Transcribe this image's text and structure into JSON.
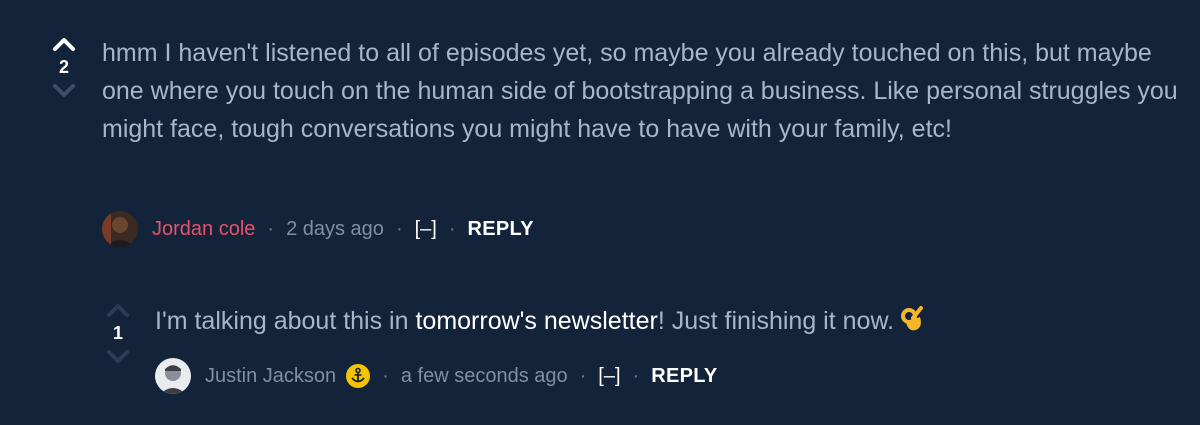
{
  "comments": [
    {
      "score": "2",
      "text": "hmm I haven't listened to all of episodes yet, so maybe you already touched on this, but maybe one where you touch on the human side of bootstrapping a business. Like personal struggles you might face, tough conversations you might have to have with your family, etc!",
      "author": "Jordan cole",
      "author_color": "#e8516c",
      "time": "2 days ago",
      "collapse_label": "[–]",
      "reply_label": "REPLY",
      "upvote_icon": "chevron-up-icon",
      "downvote_icon": "chevron-down-icon"
    },
    {
      "score": "1",
      "text_before": "I'm talking about this in ",
      "link_text": "tomorrow's newsletter",
      "text_after": "! Just finishing it now.",
      "emoji": "ok-hand-icon",
      "author": "Justin Jackson",
      "badge_icon": "anchor-icon",
      "time": "a few seconds ago",
      "collapse_label": "[–]",
      "reply_label": "REPLY",
      "upvote_icon": "chevron-up-icon",
      "downvote_icon": "chevron-down-icon"
    }
  ],
  "separator": "·",
  "colors": {
    "background": "#13233a",
    "body_text": "#a8b6c8",
    "meta_text": "#7f8fa5",
    "author_highlight": "#e8516c",
    "link": "#ffffff",
    "badge": "#f5c400"
  }
}
